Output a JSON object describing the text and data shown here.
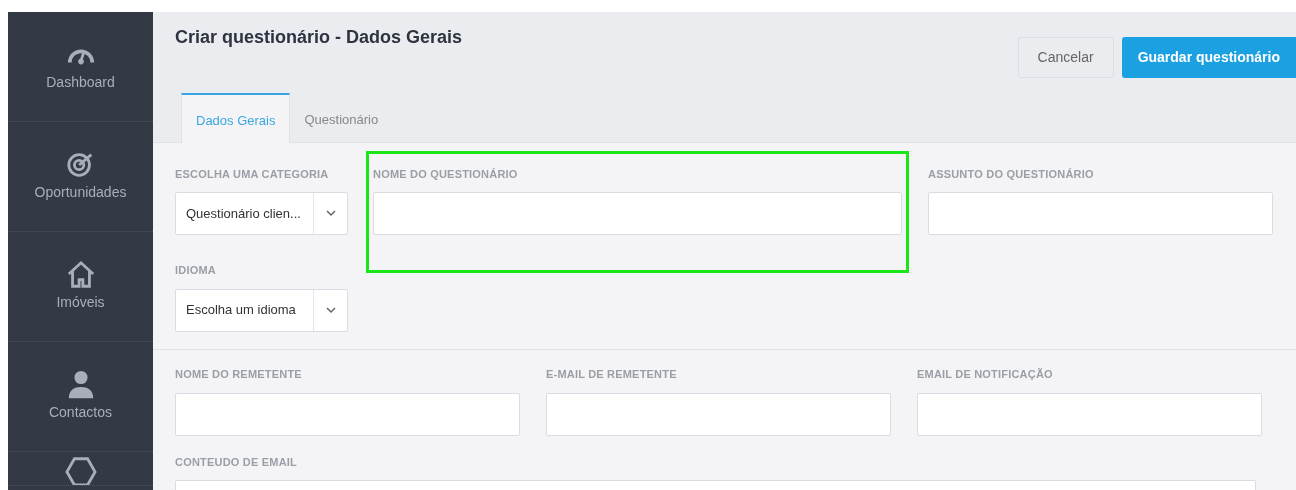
{
  "sidebar": {
    "items": [
      {
        "kind": "gauge",
        "label": "Dashboard"
      },
      {
        "kind": "target",
        "label": "Oportunidades"
      },
      {
        "kind": "house",
        "label": "Imóveis"
      },
      {
        "kind": "person",
        "label": "Contactos"
      },
      {
        "kind": "hexagon"
      }
    ]
  },
  "header": {
    "title": "Criar questionário - Dados Gerais",
    "buttons": [
      {
        "kind": "secondary",
        "label": "Cancelar"
      },
      {
        "kind": "primary",
        "label": "Guardar questionário"
      }
    ]
  },
  "tabs": [
    {
      "label": "Dados Gerais",
      "selected": true
    },
    {
      "label": "Questionário",
      "selected": false
    }
  ],
  "general": {
    "category": {
      "label": "ESCOLHA UMA CATEGORIA",
      "value": "Questionário clien..."
    },
    "language": {
      "label": "IDIOMA",
      "value": "Escolha um idioma"
    },
    "name": {
      "label": "NOME DO QUESTIONÁRIO",
      "highlighted": true
    },
    "subject": {
      "label": "ASSUNTO DO QUESTIONÁRIO",
      "highlighted": false
    }
  },
  "sender": {
    "fields": [
      {
        "label": "NOME DO REMETENTE"
      },
      {
        "label": "E-MAIL DE REMETENTE"
      },
      {
        "label": "EMAIL DE NOTIFICAÇÃO"
      }
    ],
    "content": {
      "label": "CONTEUDO DE EMAIL"
    }
  }
}
